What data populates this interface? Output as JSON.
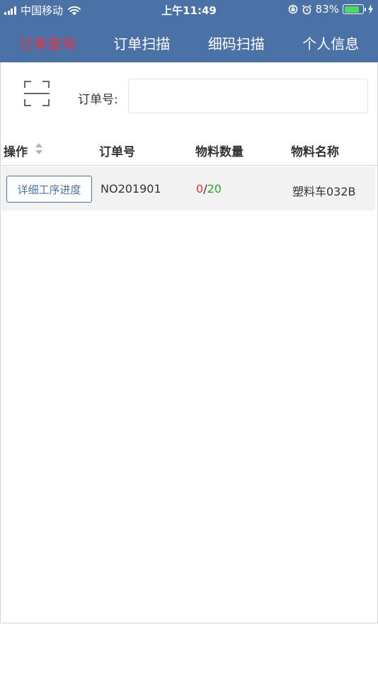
{
  "status_bar": {
    "carrier": "中国移动",
    "time": "上午11:49",
    "battery": "83%",
    "battery_fraction": 0.83,
    "battery_color": "#4cd964"
  },
  "nav": {
    "tabs": [
      {
        "label": "订单查询",
        "active": true
      },
      {
        "label": "订单扫描",
        "active": false
      },
      {
        "label": "细码扫描",
        "active": false
      },
      {
        "label": "个人信息",
        "active": false
      }
    ]
  },
  "search": {
    "label": "订单号:",
    "value": "",
    "placeholder": "",
    "scan_icon": "scan-icon"
  },
  "table": {
    "columns": [
      "操作",
      "订单号",
      "物料数量",
      "物料名称"
    ],
    "rows": [
      {
        "action": "详细工序进度",
        "order_no": "NO201901",
        "qty_done": "0",
        "qty_sep": "/",
        "qty_total": "20",
        "material_name": "塑料车032B"
      }
    ]
  },
  "colors": {
    "header_bg": "#4a72a6",
    "active_tab": "#e8323c",
    "qty_done": "#e8323c",
    "qty_total": "#2aa12a"
  }
}
